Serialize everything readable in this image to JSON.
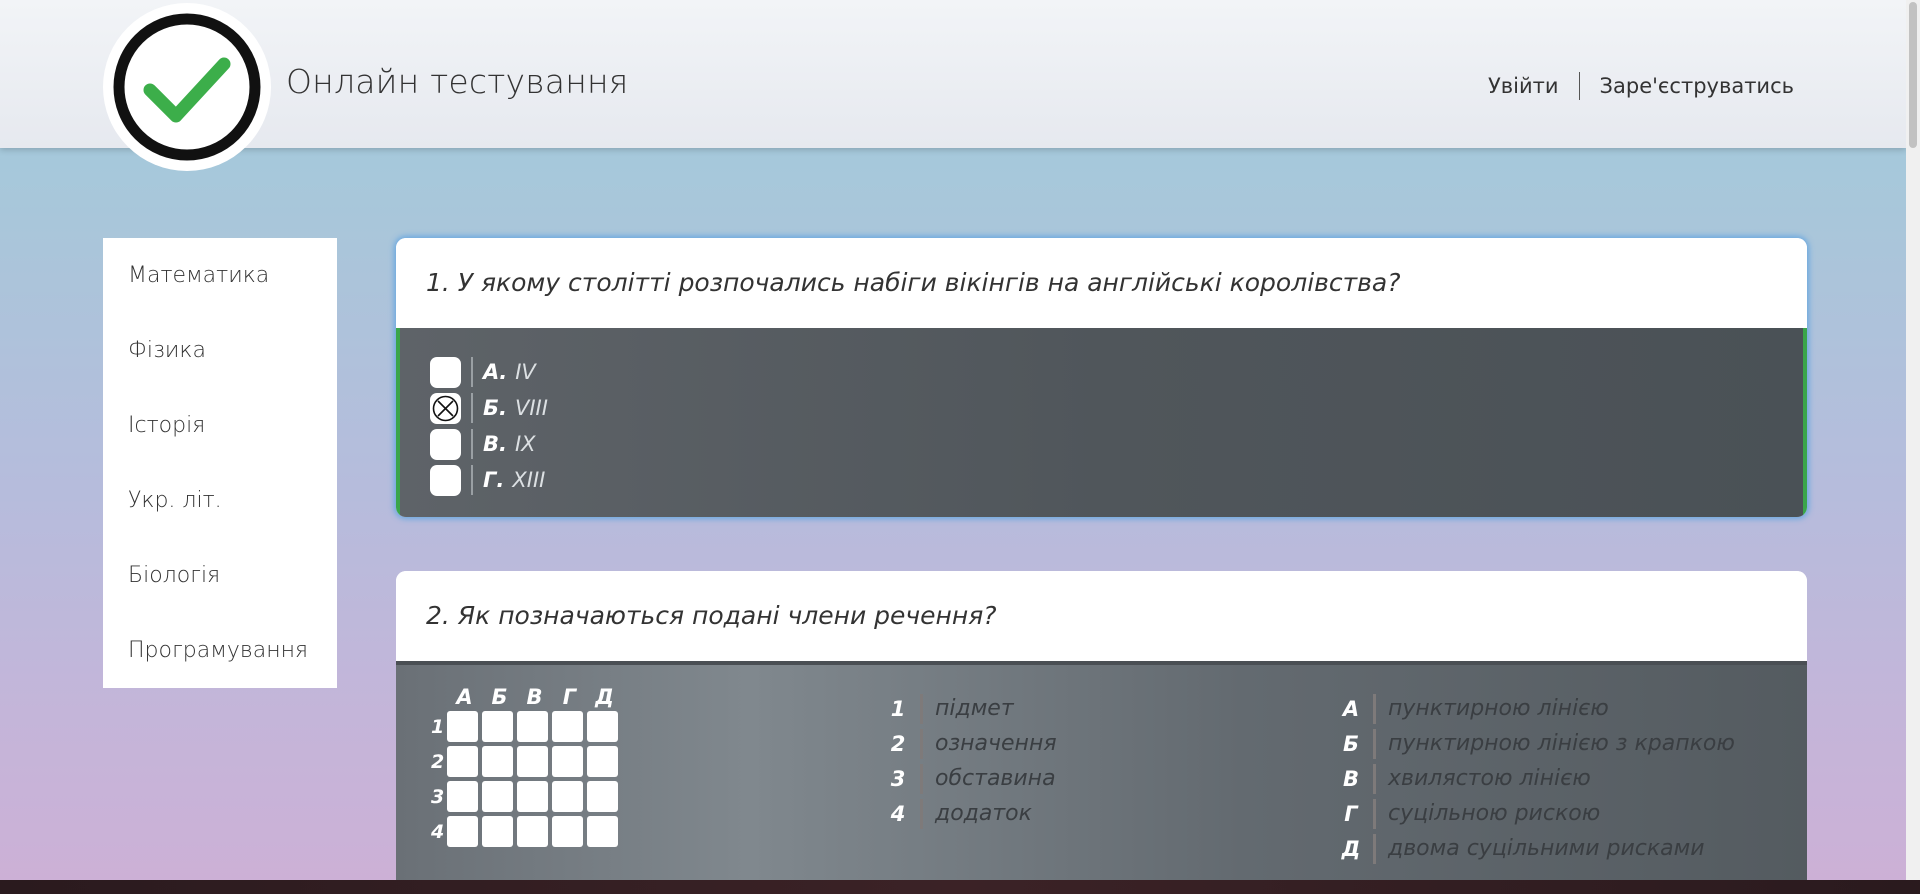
{
  "header": {
    "site_title": "Онлайн тестування",
    "login": "Увійти",
    "register": "Заре'єструватись",
    "logo_icon": "check-mark-icon"
  },
  "sidebar": {
    "items": [
      {
        "label": "Математика"
      },
      {
        "label": "Фізика"
      },
      {
        "label": "Історія"
      },
      {
        "label": "Укр. літ."
      },
      {
        "label": "Біологія"
      },
      {
        "label": "Програмування"
      }
    ]
  },
  "question1": {
    "text": "1. У якому столітті розпочались набіги вікінгів на англійські королівства?",
    "options": [
      {
        "letter": "А.",
        "value": "IV",
        "checked": false
      },
      {
        "letter": "Б.",
        "value": "VIII",
        "checked": true
      },
      {
        "letter": "В.",
        "value": "IX",
        "checked": false
      },
      {
        "letter": "Г.",
        "value": "XIII",
        "checked": false
      }
    ]
  },
  "question2": {
    "text": "2. Як позначаються подані члени речення?",
    "grid_columns": [
      "А",
      "Б",
      "В",
      "Г",
      "Д"
    ],
    "grid_rows": [
      "1",
      "2",
      "3",
      "4"
    ],
    "left_items": [
      {
        "key": "1",
        "text": "підмет"
      },
      {
        "key": "2",
        "text": "означення"
      },
      {
        "key": "3",
        "text": "обставина"
      },
      {
        "key": "4",
        "text": "додаток"
      }
    ],
    "right_items": [
      {
        "key": "А",
        "text": "пунктирною лінією"
      },
      {
        "key": "Б",
        "text": "пунктирною лінією з крапкою"
      },
      {
        "key": "В",
        "text": "хвилястою лінією"
      },
      {
        "key": "Г",
        "text": "суцільною рискою"
      },
      {
        "key": "Д",
        "text": "двома суцільними рисками"
      }
    ]
  },
  "colors": {
    "accent_green": "#3aa54a",
    "active_outline": "#6aa8e0"
  }
}
